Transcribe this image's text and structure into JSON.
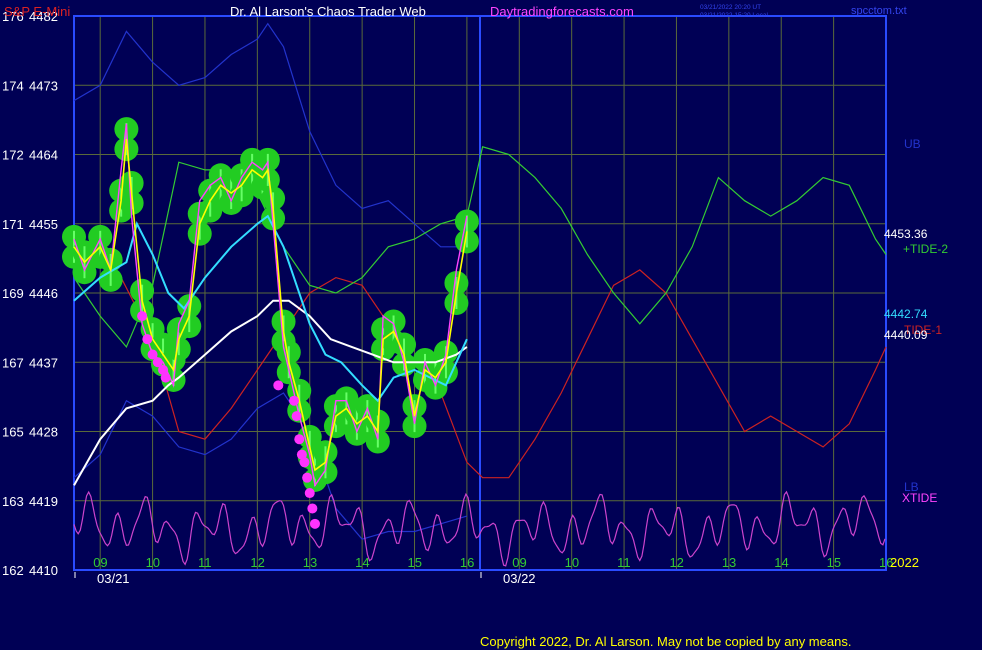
{
  "header": {
    "symbol": "S&P E-Mini",
    "title": "Dr. Al Larson's Chaos Trader Web",
    "site": "Daytradingforecasts.com",
    "stamp_utc": "03/21/2022 20:20 UT",
    "stamp_local": "03/21/2022 15:20 Local",
    "file": "spcctom.txt"
  },
  "footer": {
    "copyright": "Copyright 2022, Dr. Al Larson. May not be copied by any means."
  },
  "colors": {
    "background": "#000055",
    "plot_border": "#2a4bff",
    "grid": "#5a6a3a",
    "price_glow": "#22cc22",
    "price_line": "#ffff00",
    "fast_line": "#ff44ff",
    "blue_avg": "#33ddff",
    "white_avg": "#ffffff",
    "upper_band": "#2233cc",
    "tide1": "#cc2222",
    "tide2": "#33cc33",
    "xtide": "#cc44cc",
    "peak_dots": "#ff33ff"
  },
  "chart_data": {
    "type": "line",
    "title": "S&P E-Mini",
    "y_left_labels": [
      "176",
      "174",
      "172",
      "171",
      "169",
      "167",
      "165",
      "163",
      "162"
    ],
    "y_right_labels": [
      "4482",
      "4473",
      "4464",
      "4455",
      "4446",
      "4437",
      "4428",
      "4419",
      "4410"
    ],
    "y_range": [
      4410,
      4482
    ],
    "time_labels": [
      "09",
      "10",
      "11",
      "12",
      "13",
      "14",
      "15",
      "16",
      "09",
      "10",
      "11",
      "12",
      "13",
      "14",
      "15",
      "16"
    ],
    "x_range": [
      8.5,
      24.0
    ],
    "date_labels": [
      "03/21",
      "03/22"
    ],
    "year_label": "2022",
    "grid": true,
    "series": [
      {
        "name": "UB",
        "label": "UB",
        "color": "#2233cc",
        "x": [
          8.5,
          9.0,
          9.5,
          10.0,
          10.5,
          11.0,
          11.5,
          12.0,
          12.2,
          12.5,
          13.0,
          13.5,
          14.0,
          14.5,
          15.0,
          15.5,
          16.0
        ],
        "y": [
          4471,
          4473,
          4480,
          4476,
          4473,
          4474,
          4477,
          4479,
          4481,
          4478,
          4467,
          4460,
          4457,
          4458,
          4455,
          4452,
          4452
        ]
      },
      {
        "name": "LB",
        "label": "LB",
        "color": "#2233cc",
        "x": [
          8.5,
          9.0,
          9.5,
          10.0,
          10.5,
          11.0,
          11.5,
          12.0,
          12.5,
          13.0,
          13.5,
          14.0,
          14.5,
          15.0,
          15.5,
          16.0
        ],
        "y": [
          4422,
          4425,
          4432,
          4430,
          4426,
          4425,
          4427,
          4431,
          4433,
          4428,
          4418,
          4414,
          4415,
          4415,
          4416,
          4417
        ]
      },
      {
        "name": "TIDE-1",
        "label": "TIDE-1",
        "color": "#cc2222",
        "x": [
          9.4,
          10.0,
          10.5,
          11.0,
          11.5,
          12.0,
          12.5,
          13.0,
          13.5,
          14.0,
          14.5,
          15.0,
          15.5,
          16.0,
          16.3,
          16.8,
          17.3,
          17.8,
          18.3,
          18.8,
          19.3,
          19.8,
          20.3,
          20.8,
          21.3,
          21.8,
          22.3,
          22.8,
          23.3,
          23.8,
          24.0
        ],
        "y": [
          4448,
          4440,
          4428,
          4427,
          4431,
          4436,
          4441,
          4446,
          4448,
          4447,
          4442,
          4437,
          4433,
          4424,
          4422,
          4422,
          4427,
          4433,
          4440,
          4447,
          4449,
          4446,
          4440,
          4434,
          4428,
          4430,
          4428,
          4426,
          4429,
          4436,
          4439
        ]
      },
      {
        "name": "+TIDE-2",
        "label": "+TIDE-2",
        "color": "#33cc33",
        "x": [
          8.5,
          9.0,
          9.5,
          10.0,
          10.5,
          11.0,
          11.5,
          12.0,
          12.5,
          13.0,
          13.5,
          14.0,
          14.5,
          15.0,
          15.5,
          16.0,
          16.3,
          16.8,
          17.3,
          17.8,
          18.3,
          18.8,
          19.3,
          19.8,
          20.3,
          20.8,
          21.3,
          21.8,
          22.3,
          22.8,
          23.3,
          23.8,
          24.0
        ],
        "y": [
          4448,
          4443,
          4439,
          4447,
          4463,
          4462,
          4462,
          4459,
          4452,
          4447,
          4446,
          4448,
          4452,
          4453,
          4455,
          4456,
          4465,
          4464,
          4461,
          4457,
          4451,
          4446,
          4442,
          4446,
          4452,
          4461,
          4458,
          4456,
          4458,
          4461,
          4460,
          4453,
          4451
        ]
      },
      {
        "name": "XTIDE",
        "label": "XTIDE",
        "color": "#cc44cc",
        "x": [
          8.5,
          9.5,
          10.5,
          11.5,
          12.5,
          13.5,
          14.5,
          15.5,
          16.5,
          17.5,
          18.5,
          19.5,
          20.5,
          21.5,
          22.5,
          23.5,
          24.0
        ],
        "y": [
          4416,
          4416,
          4415,
          4415,
          4416,
          4416,
          4415,
          4416,
          4415,
          4415,
          4416,
          4415,
          4415,
          4416,
          4416,
          4416,
          4417
        ]
      },
      {
        "name": "Price",
        "label": "",
        "color": "#ffff00",
        "x": [
          8.5,
          8.7,
          9.0,
          9.2,
          9.4,
          9.5,
          9.6,
          9.8,
          10.0,
          10.2,
          10.4,
          10.5,
          10.7,
          10.9,
          11.1,
          11.3,
          11.5,
          11.7,
          11.9,
          12.1,
          12.2,
          12.3,
          12.5,
          12.6,
          12.8,
          13.0,
          13.1,
          13.3,
          13.5,
          13.7,
          13.9,
          14.1,
          14.3,
          14.4,
          14.6,
          14.8,
          15.0,
          15.2,
          15.4,
          15.6,
          15.8,
          16.0
        ],
        "y": [
          4452,
          4450,
          4452,
          4449,
          4458,
          4466,
          4459,
          4445,
          4440,
          4438,
          4436,
          4440,
          4443,
          4455,
          4458,
          4460,
          4459,
          4460,
          4462,
          4461,
          4462,
          4457,
          4441,
          4437,
          4432,
          4426,
          4423,
          4424,
          4430,
          4431,
          4429,
          4430,
          4428,
          4440,
          4441,
          4438,
          4430,
          4436,
          4435,
          4437,
          4446,
          4454
        ]
      },
      {
        "name": "Fast",
        "label": "",
        "color": "#ff44ff",
        "x": [
          8.5,
          8.7,
          9.0,
          9.2,
          9.4,
          9.5,
          9.6,
          9.8,
          10.0,
          10.2,
          10.4,
          10.5,
          10.7,
          10.9,
          11.1,
          11.3,
          11.5,
          11.7,
          11.9,
          12.1,
          12.2,
          12.3,
          12.5,
          12.6,
          12.8,
          13.0,
          13.1,
          13.3,
          13.5,
          13.7,
          13.9,
          14.1,
          14.3,
          14.4,
          14.6,
          14.8,
          15.0,
          15.2,
          15.4,
          15.6,
          15.8,
          16.0
        ],
        "y": [
          4453,
          4449,
          4453,
          4449,
          4462,
          4468,
          4456,
          4442,
          4438,
          4437,
          4434,
          4442,
          4445,
          4458,
          4460,
          4461,
          4458,
          4461,
          4463,
          4462,
          4463,
          4455,
          4439,
          4436,
          4430,
          4425,
          4421,
          4423,
          4432,
          4432,
          4428,
          4431,
          4427,
          4443,
          4442,
          4437,
          4429,
          4437,
          4434,
          4438,
          4449,
          4456
        ]
      },
      {
        "name": "Blue avg",
        "label": "",
        "color": "#33ddff",
        "x": [
          8.5,
          9.0,
          9.5,
          9.7,
          10.0,
          10.3,
          10.6,
          11.0,
          11.5,
          12.0,
          12.2,
          12.5,
          13.0,
          13.3,
          13.6,
          14.0,
          14.3,
          14.6,
          15.0,
          15.3,
          15.6,
          16.0
        ],
        "y": [
          4445,
          4448,
          4450,
          4455,
          4451,
          4446,
          4444,
          4448,
          4452,
          4455,
          4456,
          4452,
          4442,
          4438,
          4437,
          4434,
          4432,
          4435,
          4436,
          4435,
          4434,
          4440
        ]
      },
      {
        "name": "White avg",
        "label": "",
        "color": "#ffffff",
        "x": [
          8.5,
          9.0,
          9.5,
          10.0,
          10.3,
          10.5,
          11.0,
          11.5,
          12.0,
          12.3,
          12.6,
          13.0,
          13.4,
          13.8,
          14.2,
          14.6,
          15.0,
          15.4,
          15.8,
          16.0
        ],
        "y": [
          4421,
          4427,
          4431,
          4432,
          4434,
          4435,
          4438,
          4441,
          4443,
          4445,
          4445,
          4443,
          4440,
          4439,
          4438,
          4437,
          4437,
          4437,
          4438,
          4439
        ]
      }
    ],
    "peak_dots": [
      {
        "x": 9.8,
        "y": 4443
      },
      {
        "x": 9.9,
        "y": 4440
      },
      {
        "x": 10.0,
        "y": 4438
      },
      {
        "x": 10.1,
        "y": 4437
      },
      {
        "x": 10.2,
        "y": 4436
      },
      {
        "x": 10.25,
        "y": 4435
      },
      {
        "x": 12.4,
        "y": 4434
      },
      {
        "x": 12.7,
        "y": 4432
      },
      {
        "x": 12.75,
        "y": 4430
      },
      {
        "x": 12.8,
        "y": 4427
      },
      {
        "x": 12.85,
        "y": 4425
      },
      {
        "x": 12.9,
        "y": 4424
      },
      {
        "x": 12.95,
        "y": 4422
      },
      {
        "x": 13.0,
        "y": 4420
      },
      {
        "x": 13.05,
        "y": 4418
      },
      {
        "x": 13.1,
        "y": 4416
      }
    ],
    "right_value_labels": [
      {
        "text": "4453.36",
        "color": "#ffffff",
        "y": 4453.36
      },
      {
        "text": "4442.74",
        "color": "#33ddff",
        "y": 4442.74
      },
      {
        "text": "4440.09",
        "color": "#ffffff",
        "y": 4440.09
      }
    ]
  }
}
